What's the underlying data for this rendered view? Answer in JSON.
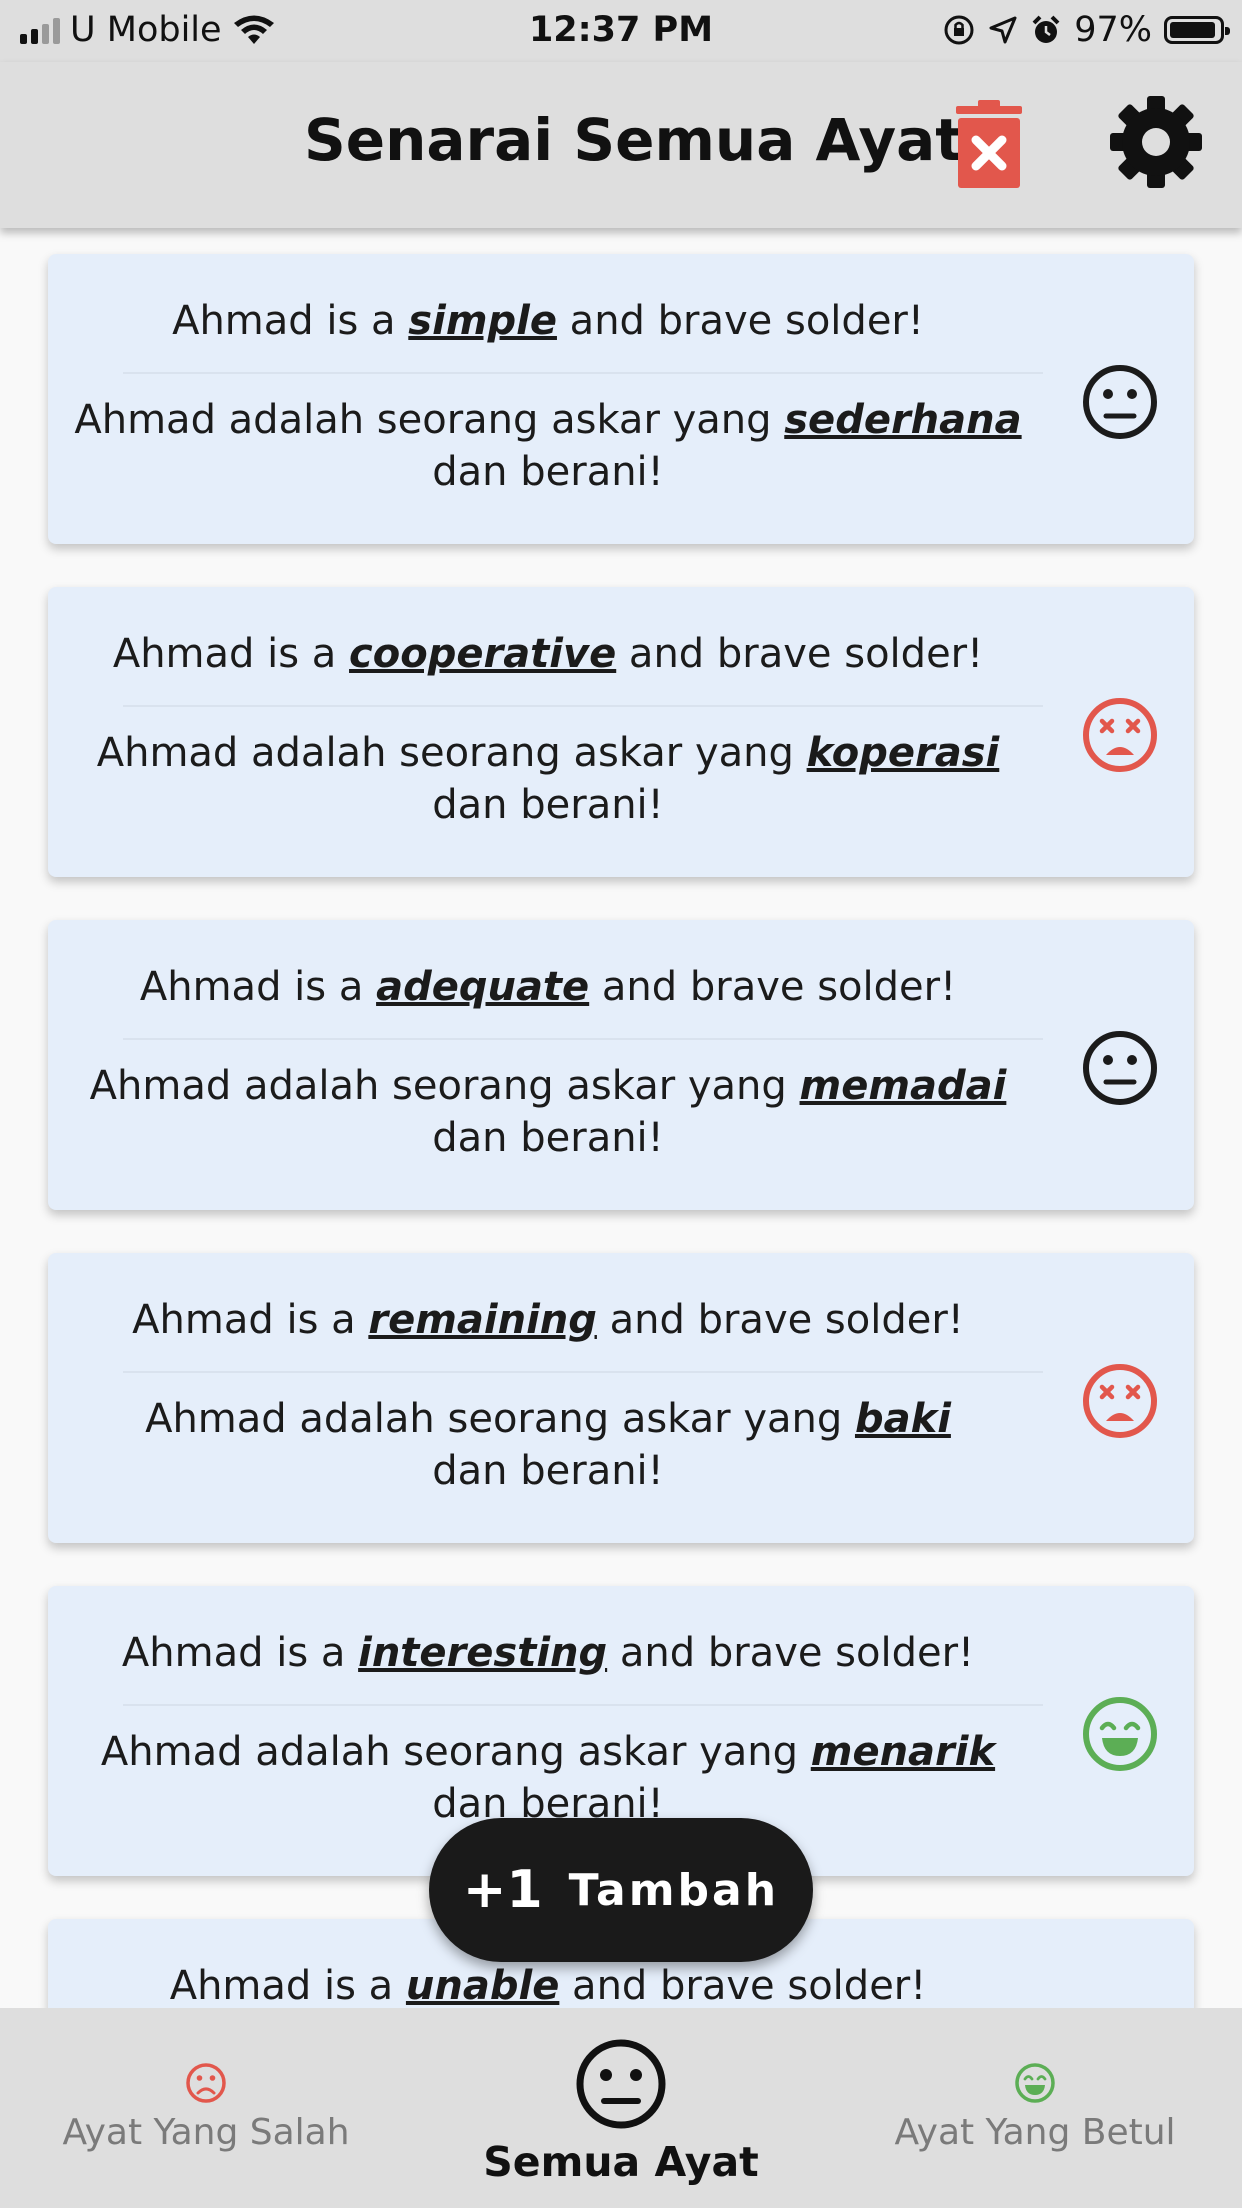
{
  "status_bar": {
    "carrier": "U Mobile",
    "time": "12:37 PM",
    "battery": "97%"
  },
  "app_bar": {
    "title": "Senarai Semua Ayat",
    "icons": [
      "delete-icon",
      "settings-icon"
    ]
  },
  "colors": {
    "wrong": "#e2574c",
    "correct": "#5cae55",
    "neutral": "#1b1b1b",
    "card": "#e5eefa"
  },
  "cards": [
    {
      "en_before": "Ahmad is a ",
      "en_word": "simple",
      "en_after": " and brave solder!",
      "ms_before": "Ahmad adalah seorang askar yang ",
      "ms_word": "sederhana",
      "ms_after": "dan berani!",
      "status": "neutral"
    },
    {
      "en_before": "Ahmad is a ",
      "en_word": "cooperative",
      "en_after": " and brave solder!",
      "ms_before": "Ahmad adalah seorang askar yang ",
      "ms_word": "koperasi",
      "ms_after": "dan berani!",
      "status": "wrong"
    },
    {
      "en_before": "Ahmad is a ",
      "en_word": "adequate",
      "en_after": " and brave solder!",
      "ms_before": "Ahmad adalah seorang askar yang ",
      "ms_word": "memadai",
      "ms_after": "dan berani!",
      "status": "neutral"
    },
    {
      "en_before": "Ahmad is a ",
      "en_word": "remaining",
      "en_after": " and brave solder!",
      "ms_before": "Ahmad adalah seorang askar yang ",
      "ms_word": "baki",
      "ms_after": "dan berani!",
      "status": "wrong"
    },
    {
      "en_before": "Ahmad is a ",
      "en_word": "interesting",
      "en_after": " and brave solder!",
      "ms_before": "Ahmad adalah seorang askar yang ",
      "ms_word": "menarik",
      "ms_after": "dan berani!",
      "status": "correct"
    },
    {
      "en_before": "Ahmad is a ",
      "en_word": "unable",
      "en_after": " and brave solder!",
      "ms_before": "",
      "ms_word": "",
      "ms_after": "",
      "status": "neutral"
    }
  ],
  "fab": {
    "icon_text": "+1",
    "label": "Tambah"
  },
  "bottom_nav": [
    {
      "label": "Ayat Yang Salah",
      "icon": "sad-face-icon",
      "active": false
    },
    {
      "label": "Semua Ayat",
      "icon": "neutral-face-icon",
      "active": true
    },
    {
      "label": "Ayat Yang Betul",
      "icon": "happy-face-icon",
      "active": false
    }
  ]
}
